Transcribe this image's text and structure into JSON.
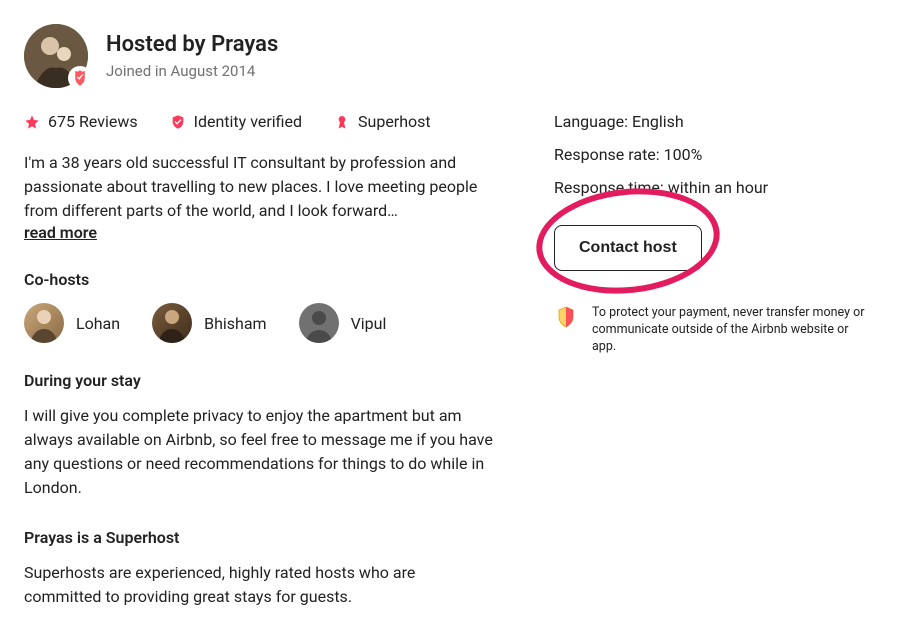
{
  "header": {
    "title": "Hosted by Prayas",
    "joined": "Joined in August 2014"
  },
  "stats": {
    "reviews": "675 Reviews",
    "verified": "Identity verified",
    "superhost": "Superhost"
  },
  "bio": {
    "text": "I'm a 38 years old successful IT consultant by profession and passionate about travelling to new places. I love meeting people from different parts of the world, and I look forward…",
    "read_more": "read more"
  },
  "cohosts": {
    "title": "Co-hosts",
    "items": [
      {
        "name": "Lohan"
      },
      {
        "name": "Bhisham"
      },
      {
        "name": "Vipul"
      }
    ]
  },
  "during": {
    "title": "During your stay",
    "text": "I will give you complete privacy to enjoy the apartment but am always available on Airbnb, so feel free to message me if you have any questions or need recommendations for things to do while in London."
  },
  "superhost_section": {
    "title": "Prayas is a Superhost",
    "text": "Superhosts are experienced, highly rated hosts who are committed to providing great stays for guests."
  },
  "right": {
    "language": "Language: English",
    "response_rate": "Response rate: 100%",
    "response_time": "Response time: within an hour",
    "contact": "Contact host",
    "protect": "To protect your payment, never transfer money or communicate outside of the Airbnb website or app."
  }
}
